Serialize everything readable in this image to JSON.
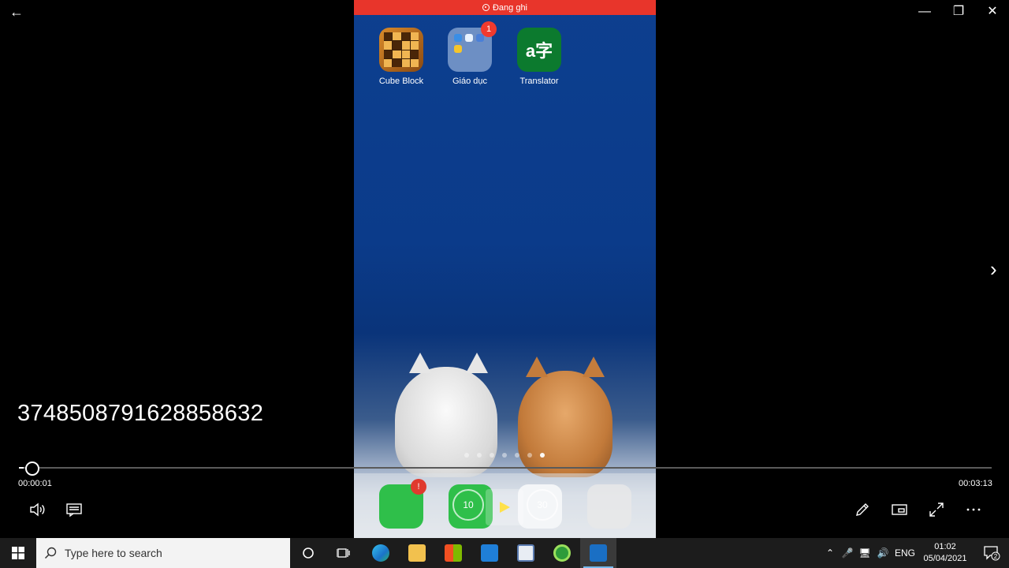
{
  "phone": {
    "status_bar": {
      "label": "Đang ghi",
      "color": "#e8352b"
    },
    "apps": [
      {
        "label": "Cube Block",
        "icon": "cube-block-icon"
      },
      {
        "label": "Giáo dục",
        "icon": "folder-icon",
        "badge": "1"
      },
      {
        "label": "Translator",
        "icon": "translator-icon",
        "glyph": "a字"
      }
    ],
    "page_dots": 7,
    "active_page_dot": 6,
    "dock": {
      "messages_badge": "!",
      "skip_back_label": "10",
      "skip_forward_label": "30"
    }
  },
  "overlay": {
    "title": "374850879162885863​2"
  },
  "player": {
    "current_time": "00:00:01",
    "total_time": "00:03:13",
    "progress": 0.005
  },
  "taskbar": {
    "search_placeholder": "Type here to search",
    "language": "ENG",
    "time": "01:02",
    "date": "05/04/2021",
    "notification_count": "2",
    "accent": "#76b9ed"
  }
}
